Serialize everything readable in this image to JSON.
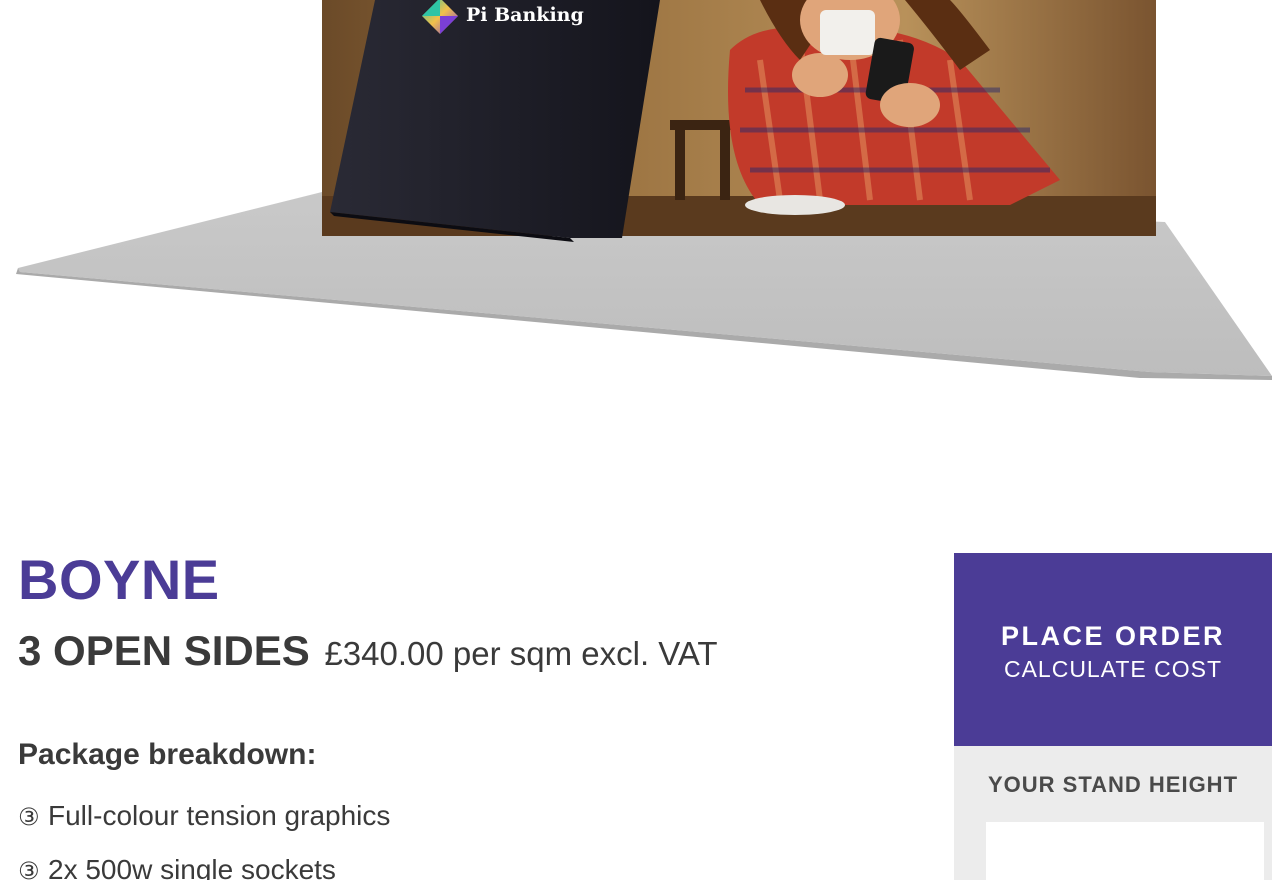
{
  "hero": {
    "brand_logo_text": "Pi Banking"
  },
  "product": {
    "name": "BOYNE",
    "variant": "3 OPEN SIDES",
    "price": "£340.00 per sqm excl. VAT",
    "breakdown_heading": "Package breakdown:",
    "bullet_symbol": "③",
    "features": [
      "Full-colour tension graphics",
      "2x 500w single sockets"
    ]
  },
  "order_panel": {
    "title": "PLACE ORDER",
    "subtitle": "CALCULATE COST",
    "height_label": "YOUR STAND HEIGHT",
    "height_value": ""
  },
  "colors": {
    "brand_purple": "#4b3c96",
    "text_dark": "#3a3a3a",
    "panel_grey": "#ececec"
  }
}
